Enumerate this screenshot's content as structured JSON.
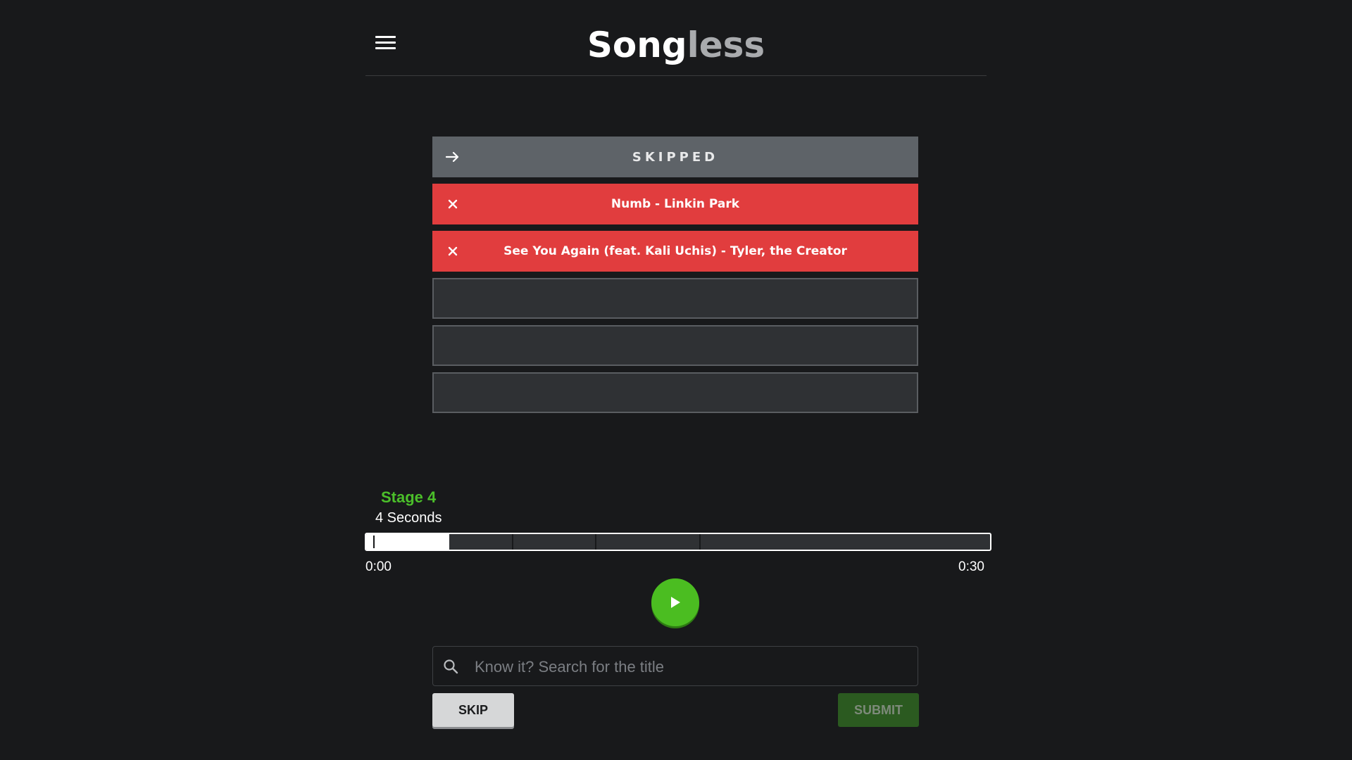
{
  "app": {
    "logo_part1": "Song",
    "logo_part2": "less"
  },
  "guesses": [
    {
      "status": "skipped",
      "icon": "arrow-right-icon",
      "text": "SKIPPED"
    },
    {
      "status": "wrong",
      "icon": "close-icon",
      "text": "Numb - Linkin Park"
    },
    {
      "status": "wrong",
      "icon": "close-icon",
      "text": "See You Again (feat. Kali Uchis) - Tyler, the Creator"
    },
    {
      "status": "empty",
      "text": ""
    },
    {
      "status": "empty",
      "text": ""
    },
    {
      "status": "empty",
      "text": ""
    }
  ],
  "stage": {
    "label": "Stage 4",
    "duration": "4 Seconds"
  },
  "player": {
    "time_start": "0:00",
    "time_end": "0:30",
    "unlocked_seconds": 4,
    "total_seconds": 30,
    "stage_boundaries_seconds": [
      1,
      2,
      4,
      7,
      11,
      16
    ]
  },
  "search": {
    "placeholder": "Know it? Search for the title",
    "value": ""
  },
  "actions": {
    "skip_label": "SKIP",
    "submit_label": "SUBMIT"
  },
  "colors": {
    "background": "#18191b",
    "accent_green": "#4bbd21",
    "wrong_red": "#e13d3e",
    "skipped_gray": "#5e6368"
  }
}
